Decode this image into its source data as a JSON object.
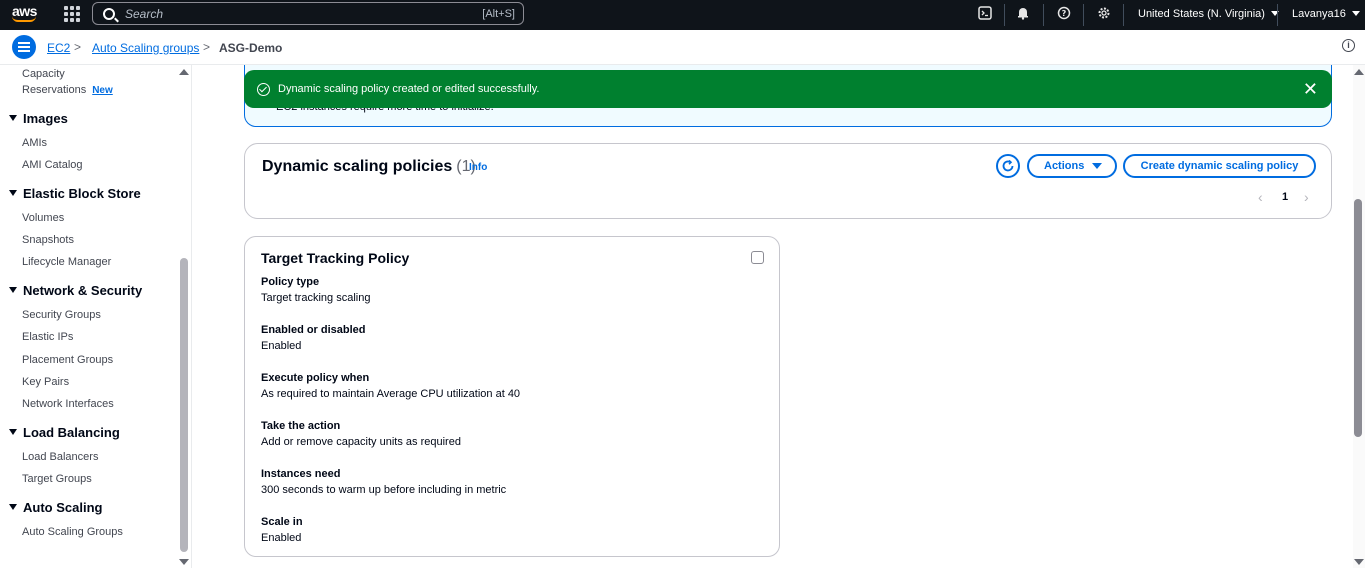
{
  "topnav": {
    "logo_text": "aws",
    "search_placeholder": "Search",
    "search_shortcut": "[Alt+S]",
    "region": "United States (N. Virginia)",
    "user": "Lavanya16",
    "icons": [
      "grid-icon",
      "search-icon",
      "terminal-icon",
      "bell-icon",
      "help-icon",
      "gear-icon"
    ]
  },
  "breadcrumb": {
    "items": [
      {
        "label": "EC2"
      },
      {
        "label": "Auto Scaling groups"
      },
      {
        "label": "ASG-Demo"
      }
    ],
    "separator": ">"
  },
  "sidebar": {
    "capacity_line1": "Capacity",
    "capacity_line2": "Reservations",
    "new_badge": "New",
    "sections": [
      {
        "heading": "Images",
        "items": [
          "AMIs",
          "AMI Catalog"
        ]
      },
      {
        "heading": "Elastic Block Store",
        "items": [
          "Volumes",
          "Snapshots",
          "Lifecycle Manager"
        ]
      },
      {
        "heading": "Network & Security",
        "items": [
          "Security Groups",
          "Elastic IPs",
          "Placement Groups",
          "Key Pairs",
          "Network Interfaces"
        ]
      },
      {
        "heading": "Load Balancing",
        "items": [
          "Load Balancers",
          "Target Groups"
        ]
      },
      {
        "heading": "Auto Scaling",
        "items": [
          "Auto Scaling Groups"
        ]
      }
    ]
  },
  "flash": {
    "message": "Dynamic scaling policy created or edited successfully.",
    "color": "#00802f"
  },
  "info_alert": {
    "partial_text": "EC2 instances require more time to initialize."
  },
  "policies": {
    "title": "Dynamic scaling policies",
    "count": "(1)",
    "info": "Info",
    "actions_label": "Actions",
    "create_label": "Create dynamic scaling policy",
    "page": "1",
    "prev": "‹",
    "next": "›"
  },
  "card": {
    "title": "Target Tracking Policy",
    "fields": [
      {
        "label": "Policy type",
        "value": "Target tracking scaling"
      },
      {
        "label": "Enabled or disabled",
        "value": "Enabled"
      },
      {
        "label": "Execute policy when",
        "value": "As required to maintain Average CPU utilization at 40"
      },
      {
        "label": "Take the action",
        "value": "Add or remove capacity units as required"
      },
      {
        "label": "Instances need",
        "value": "300 seconds to warm up before including in metric"
      },
      {
        "label": "Scale in",
        "value": "Enabled"
      }
    ]
  },
  "colors": {
    "accent": "#006ce0",
    "topnav_bg": "#0f141a",
    "success": "#00802f"
  }
}
